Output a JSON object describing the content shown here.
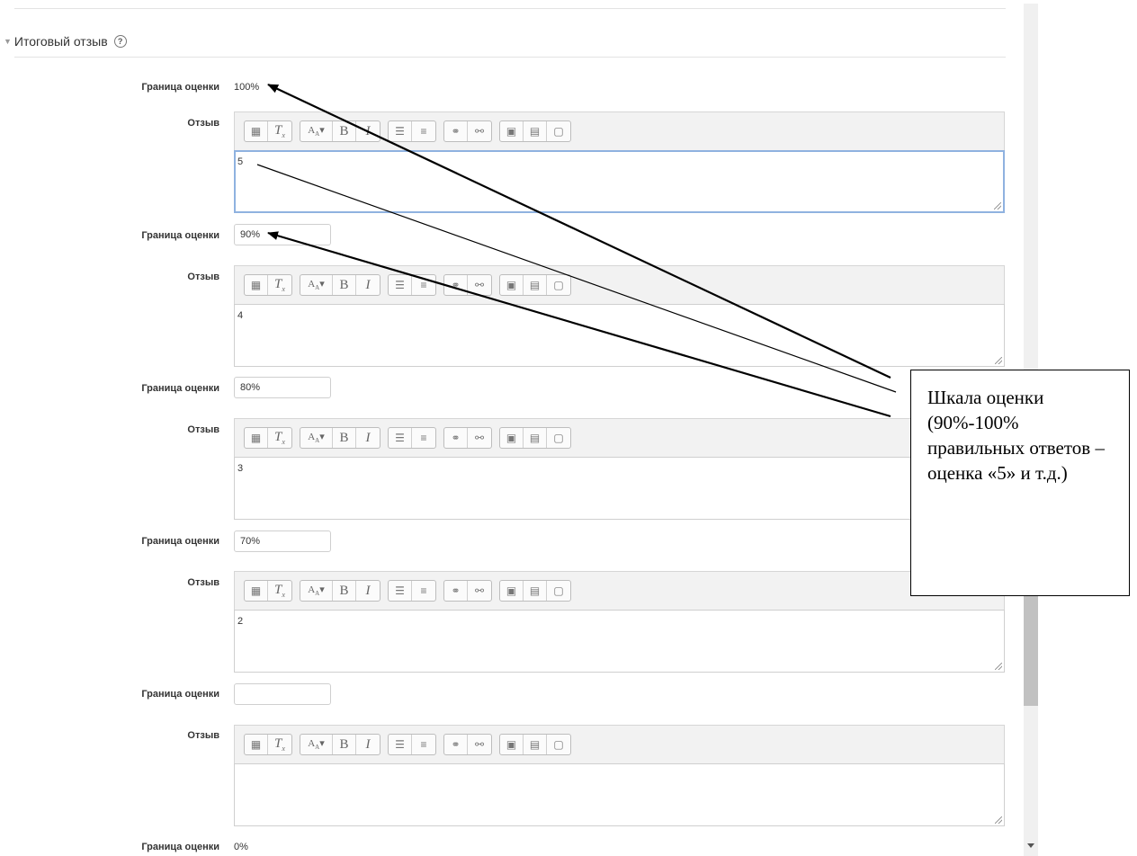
{
  "section": {
    "title": "Итоговый отзыв",
    "help_icon": "question-circle-icon",
    "toggle_icon": "caret-down-icon"
  },
  "labels": {
    "boundary": "Граница оценки",
    "feedback": "Отзыв"
  },
  "toolbar": {
    "icons": [
      "collapse-icon",
      "clear-formatting-icon",
      "font-style-icon",
      "bold-icon",
      "italic-icon",
      "unordered-list-icon",
      "ordered-list-icon",
      "link-icon",
      "unlink-icon",
      "image-icon",
      "media-icon",
      "paste-icon"
    ],
    "bold_glyph": "B",
    "italic_glyph": "I"
  },
  "rows": [
    {
      "boundary": "100%",
      "feedback": "5"
    },
    {
      "boundary": "90%",
      "feedback": "4"
    },
    {
      "boundary": "80%",
      "feedback": "3"
    },
    {
      "boundary": "70%",
      "feedback": "2"
    },
    {
      "boundary": "",
      "feedback": ""
    }
  ],
  "last_boundary": "0%",
  "callout": {
    "text": "Шкала оценки (90%-100% правильных ответов – оценка «5» и т.д.)"
  }
}
